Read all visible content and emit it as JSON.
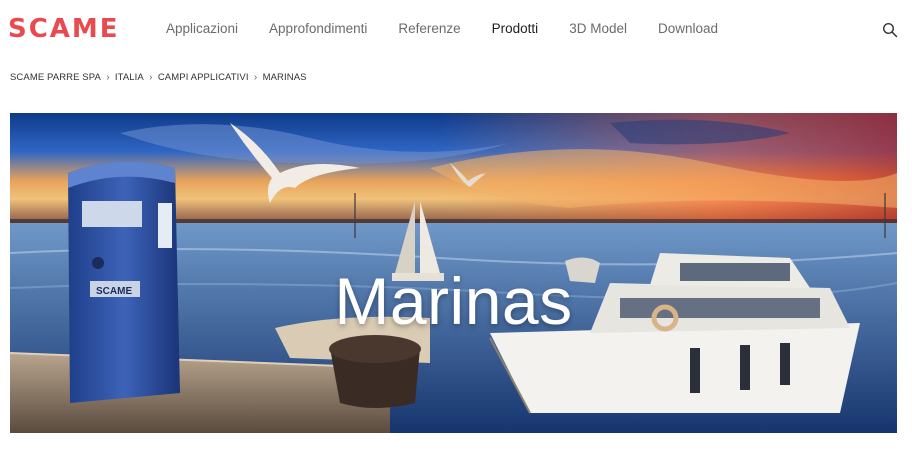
{
  "brand": {
    "logo_text": "SCAME",
    "color": "#e94a4f"
  },
  "nav": {
    "items": [
      {
        "label": "Applicazioni",
        "active": false
      },
      {
        "label": "Approfondimenti",
        "active": false
      },
      {
        "label": "Referenze",
        "active": false
      },
      {
        "label": "Prodotti",
        "active": true
      },
      {
        "label": "3D Model",
        "active": false
      },
      {
        "label": "Download",
        "active": false
      }
    ],
    "search_icon": "search-icon"
  },
  "breadcrumb": {
    "items": [
      "SCAME PARRE SPA",
      "ITALIA",
      "CAMPI APPLICATIVI",
      "MARINAS"
    ],
    "separator_icon": "chevron-right-icon"
  },
  "hero": {
    "title": "Marinas",
    "image_content": "charging pedestal, seagulls, sailboat and yacht at sunset",
    "pedestal_label": "SCAME"
  },
  "intro": {
    "text": ""
  }
}
